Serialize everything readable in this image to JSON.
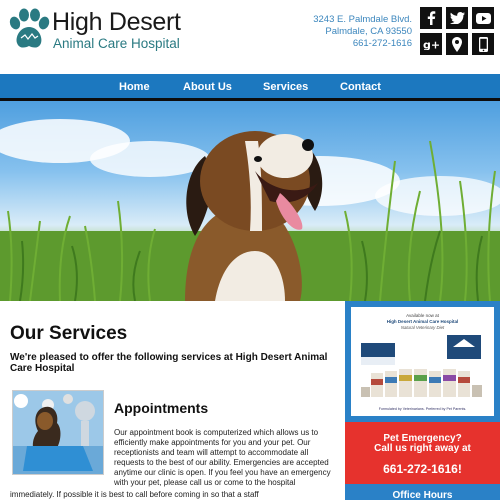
{
  "header": {
    "logo_icon": "paw-print-icon",
    "title": "High Desert",
    "subtitle": "Animal Care Hospital",
    "address_line1": "3243 E. Palmdale Blvd.",
    "address_line2": "Palmdale, CA 93550",
    "phone": "661-272-1616",
    "social": [
      "facebook-icon",
      "twitter-icon",
      "youtube-icon",
      "google-plus-icon",
      "map-pin-icon",
      "phone-icon"
    ]
  },
  "nav": {
    "items": [
      {
        "label": "Home"
      },
      {
        "label": "About Us"
      },
      {
        "label": "Services"
      },
      {
        "label": "Contact"
      }
    ]
  },
  "hero": {
    "image": "dog-in-grass-photo"
  },
  "main": {
    "title": "Our Services",
    "intro": "We're pleased to offer the following services at High Desert Animal Care Hospital",
    "appointments": {
      "image": "puppy-with-veterinarian-photo",
      "title": "Appointments",
      "text": "Our appointment book is computerized which allows us to efficiently make appointments for you and your pet. Our receptionists and team will attempt to accommodate all requests to the best of our ability. Emergencies are accepted anytime our clinic is open. If you feel you have an emergency with your pet, please call us or come to the hospital",
      "text_continued": "immediately. If possible it is best to call before coming in so that a staff"
    }
  },
  "sidebar": {
    "promo": {
      "available": "Available now at",
      "hospital": "High Desert Animal Care Hospital",
      "diet": "Natural Veterinary Diet",
      "footer": "Formulated by Veterinarians. Preferred by Pet Parents."
    },
    "emergency": {
      "line1": "Pet Emergency?",
      "line2": "Call us right away at",
      "phone": "661-272-1616!"
    },
    "hours": {
      "title": "Office Hours"
    }
  },
  "colors": {
    "nav_blue": "#1c78bf",
    "sidebar_blue": "#2a81c7",
    "emergency_red": "#e6322d",
    "address_blue": "#3b86bd",
    "logo_teal": "#2a7a82"
  }
}
